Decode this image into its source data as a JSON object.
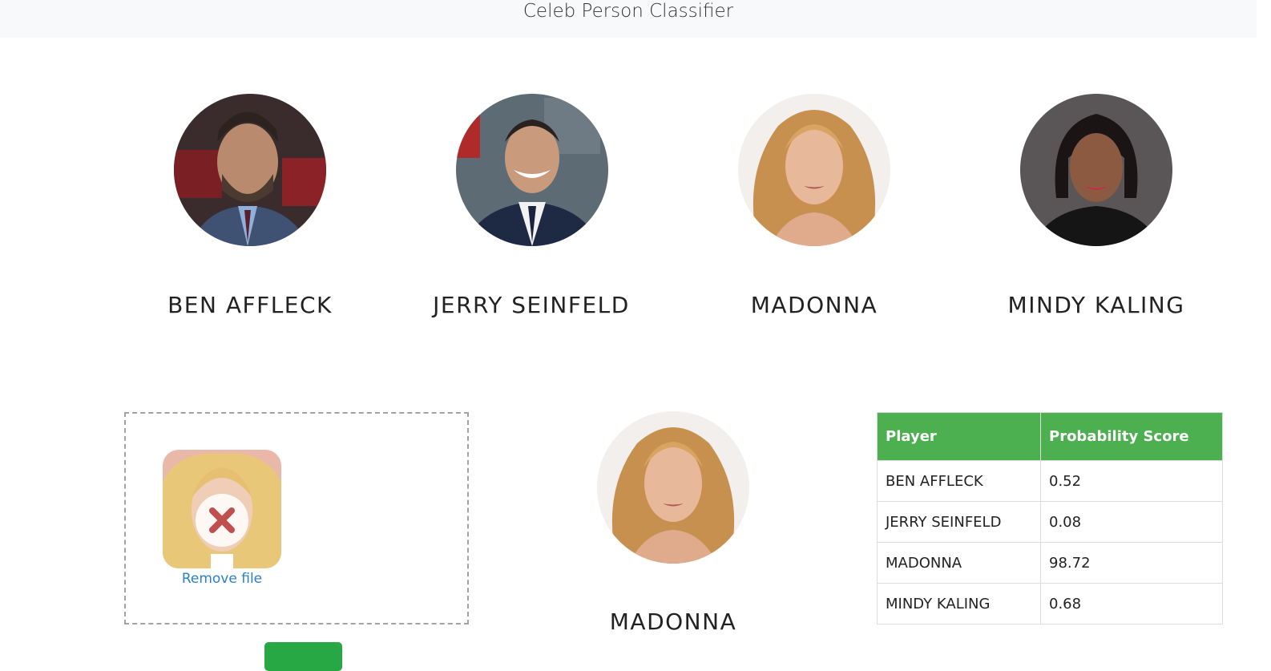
{
  "app": {
    "title": "Celeb Person Classifier"
  },
  "celebrities": [
    {
      "name": "BEN AFFLECK"
    },
    {
      "name": "JERRY SEINFELD"
    },
    {
      "name": "MADONNA"
    },
    {
      "name": "MINDY KALING"
    }
  ],
  "upload": {
    "remove_label": "Remove file",
    "button_label": ""
  },
  "result": {
    "name": "MADONNA"
  },
  "table": {
    "headers": [
      "Player",
      "Probability Score"
    ],
    "rows": [
      {
        "player": "BEN AFFLECK",
        "score": "0.52"
      },
      {
        "player": "JERRY SEINFELD",
        "score": "0.08"
      },
      {
        "player": "MADONNA",
        "score": "98.72"
      },
      {
        "player": "MINDY KALING",
        "score": "0.68"
      }
    ]
  },
  "colors": {
    "header_green": "#4caf50",
    "button_green": "#28a745",
    "link_blue": "#2a7fc9",
    "navbar_bg": "#f8f9fa"
  }
}
